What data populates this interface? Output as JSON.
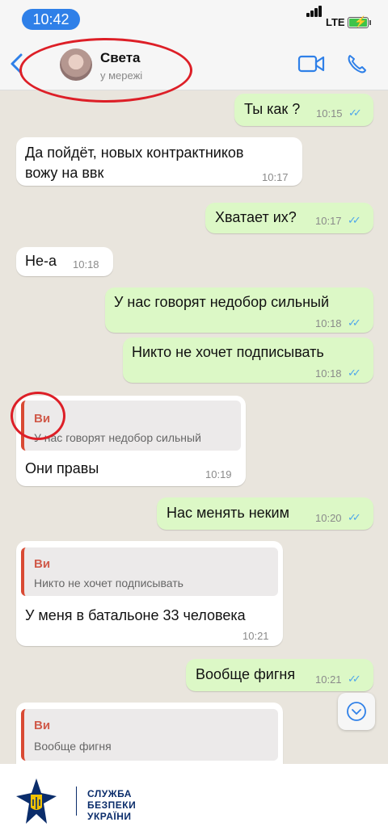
{
  "status_bar": {
    "time": "10:42",
    "network": "LTE"
  },
  "header": {
    "contact_name": "Света",
    "contact_status": "у мережі"
  },
  "messages": [
    {
      "dir": "out",
      "text": "Ты как ?",
      "time": "10:15"
    },
    {
      "dir": "in",
      "lines": [
        "Да пойдёт,  новых контрактников",
        "вожу на ввк"
      ],
      "time": "10:17"
    },
    {
      "dir": "out",
      "text": "Хватает их?",
      "time": "10:17"
    },
    {
      "dir": "in",
      "text": "Не-а",
      "time": "10:18"
    },
    {
      "dir": "out",
      "text": "У нас говорят недобор сильный",
      "time": "10:18"
    },
    {
      "dir": "out",
      "text": "Никто не хочет подписывать",
      "time": "10:18"
    },
    {
      "dir": "in",
      "quote_author": "Ви",
      "quote_text": "У нас говорят недобор сильный",
      "text": "Они правы",
      "time": "10:19"
    },
    {
      "dir": "out",
      "text": "Нас менять неким",
      "time": "10:20"
    },
    {
      "dir": "in",
      "quote_author": "Ви",
      "quote_text": "Никто не хочет подписывать",
      "text": "У меня в батальоне 33 человека",
      "time": "10:21"
    },
    {
      "dir": "out",
      "text": "Вообще фигня",
      "time": "10:21"
    },
    {
      "dir": "in",
      "quote_author": "Ви",
      "quote_text": "Вообще фигня"
    }
  ],
  "footer": {
    "org_lines": [
      "СЛУЖБА",
      "БЕЗПЕКИ",
      "УКРАЇНИ"
    ]
  },
  "colors": {
    "outgoing": "#dcf8c6",
    "incoming": "#ffffff",
    "accent": "#2f80e8",
    "highlight": "#dd1f27"
  }
}
